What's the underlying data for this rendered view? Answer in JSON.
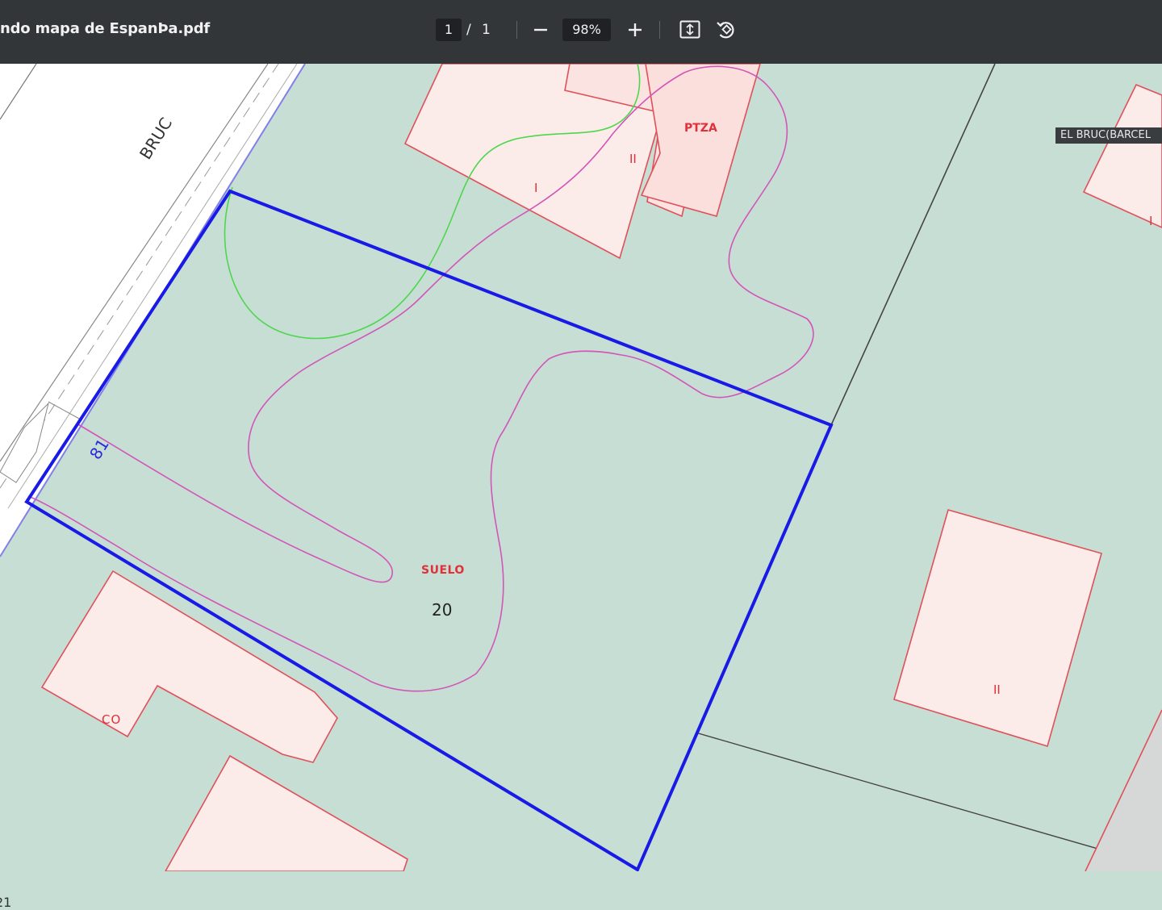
{
  "viewer": {
    "title": "ndo mapa de EspanÞa.pdf",
    "page_current": "1",
    "page_separator": "/",
    "page_total": "1",
    "zoom": "98%"
  },
  "icons": {
    "zoom_out": "minus-icon",
    "zoom_in": "plus-icon",
    "fit_page": "fit-to-page-icon",
    "rotate": "rotate-icon"
  },
  "map": {
    "corner_label": "EL BRUC(BARCEL",
    "street_name": "BRUC",
    "street_number": "81",
    "parcel_label": "SUELO",
    "parcel_number": "20",
    "building_top_label": "I",
    "building_top_secondary_label": "II",
    "building_top_tag": "PTZA",
    "building_right_top_label": "I",
    "building_right_label": "II",
    "building_bottom_left_label": "CO",
    "edge_label": "21"
  },
  "colors": {
    "toolbar": "#323639",
    "map_background": "#c7ded4",
    "parcel_border": "#1a1ae6",
    "building_fill": "#fbecea",
    "building_stroke": "#e0505a",
    "contour_magenta": "#d256b8",
    "contour_green": "#4fd64f",
    "label_red": "#e0303a"
  }
}
